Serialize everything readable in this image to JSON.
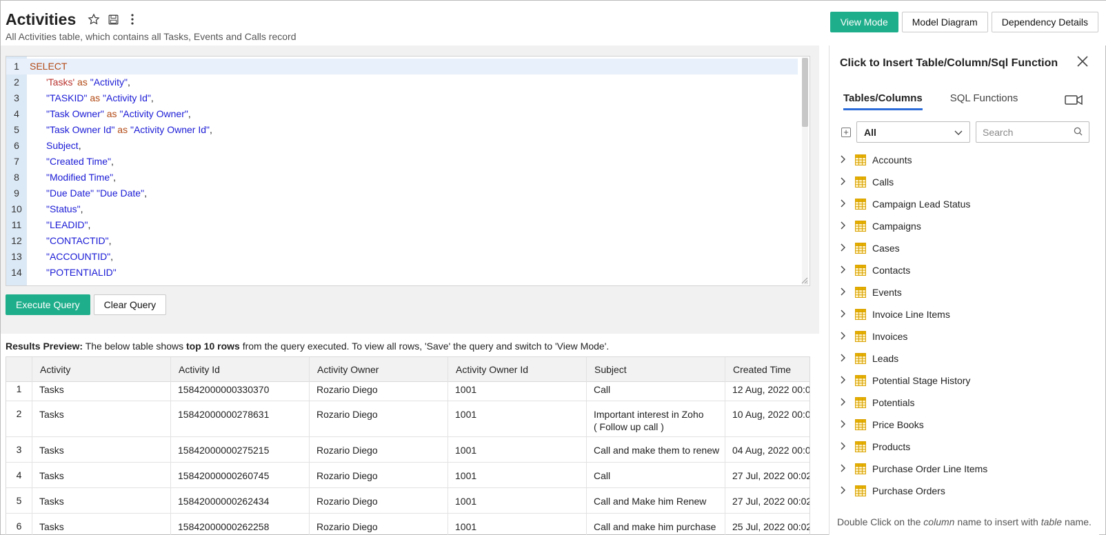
{
  "header": {
    "title": "Activities",
    "subtitle": "All Activities table, which contains all Tasks, Events and Calls record",
    "view_mode_label": "View Mode",
    "model_diagram_label": "Model Diagram",
    "dependency_details_label": "Dependency Details"
  },
  "editor": {
    "lines": [
      {
        "n": "1"
      },
      {
        "n": "2"
      },
      {
        "n": "3"
      },
      {
        "n": "4"
      },
      {
        "n": "5"
      },
      {
        "n": "6"
      },
      {
        "n": "7"
      },
      {
        "n": "8"
      },
      {
        "n": "9"
      },
      {
        "n": "10"
      },
      {
        "n": "11"
      },
      {
        "n": "12"
      },
      {
        "n": "13"
      },
      {
        "n": "14"
      }
    ],
    "tokens": {
      "l1": "SELECT",
      "l2a": "'Tasks'",
      "l2b": " as ",
      "l2c": "\"Activity\"",
      "l2d": ",",
      "l3a": "\"TASKID\"",
      "l3b": " as ",
      "l3c": "\"Activity Id\"",
      "l3d": ",",
      "l4a": "\"Task Owner\"",
      "l4b": " as ",
      "l4c": "\"Activity Owner\"",
      "l4d": ",",
      "l5a": "\"Task Owner Id\"",
      "l5b": " as ",
      "l5c": "\"Activity Owner Id\"",
      "l5d": ",",
      "l6a": "Subject",
      "l6b": ",",
      "l7a": "\"Created Time\"",
      "l7b": ",",
      "l8a": "\"Modified Time\"",
      "l8b": ",",
      "l9a": "\"Due Date\" \"Due Date\"",
      "l9b": ",",
      "l10a": "\"Status\"",
      "l10b": ",",
      "l11a": "\"LEADID\"",
      "l11b": ",",
      "l12a": "\"CONTACTID\"",
      "l12b": ",",
      "l13a": "\"ACCOUNTID\"",
      "l13b": ",",
      "l14a": "\"POTENTIALID\""
    },
    "execute_label": "Execute Query",
    "clear_label": "Clear Query"
  },
  "results": {
    "label_bold": "Results Preview:",
    "label_text1": " The below table shows ",
    "label_bold2": "top 10 rows",
    "label_text2": " from the query executed. To view all rows, 'Save' the query and switch to 'View Mode'.",
    "columns": [
      "Activity",
      "Activity Id",
      "Activity Owner",
      "Activity Owner Id",
      "Subject",
      "Created Time"
    ],
    "rows": [
      {
        "num": "1",
        "activity": "Tasks",
        "id": "15842000000330370",
        "owner": "Rozario Diego",
        "owner_id": "1001",
        "subject": "Call",
        "created": "12 Aug, 2022 00:0"
      },
      {
        "num": "2",
        "activity": "Tasks",
        "id": "15842000000278631",
        "owner": "Rozario Diego",
        "owner_id": "1001",
        "subject": "Important interest in Zoho ( Follow up call  )",
        "created": "10 Aug, 2022 00:0"
      },
      {
        "num": "3",
        "activity": "Tasks",
        "id": "15842000000275215",
        "owner": "Rozario Diego",
        "owner_id": "1001",
        "subject": "Call and make them to renew",
        "created": "04 Aug, 2022 00:0"
      },
      {
        "num": "4",
        "activity": "Tasks",
        "id": "15842000000260745",
        "owner": "Rozario Diego",
        "owner_id": "1001",
        "subject": "Call",
        "created": "27 Jul, 2022 00:02"
      },
      {
        "num": "5",
        "activity": "Tasks",
        "id": "15842000000262434",
        "owner": "Rozario Diego",
        "owner_id": "1001",
        "subject": "Call and Make him Renew",
        "created": "27 Jul, 2022 00:02"
      },
      {
        "num": "6",
        "activity": "Tasks",
        "id": "15842000000262258",
        "owner": "Rozario Diego",
        "owner_id": "1001",
        "subject": "Call and make him purchase",
        "created": "25 Jul, 2022 00:02"
      }
    ]
  },
  "panel": {
    "title": "Click to Insert Table/Column/Sql Function",
    "tab_tables": "Tables/Columns",
    "tab_functions": "SQL Functions",
    "filter_value": "All",
    "search_placeholder": "Search",
    "tables": [
      "Accounts",
      "Calls",
      "Campaign Lead Status",
      "Campaigns",
      "Cases",
      "Contacts",
      "Events",
      "Invoice Line Items",
      "Invoices",
      "Leads",
      "Potential Stage History",
      "Potentials",
      "Price Books",
      "Products",
      "Purchase Order Line Items",
      "Purchase Orders"
    ],
    "footer_a": "Double Click on the ",
    "footer_b": "column",
    "footer_c": " name to insert with ",
    "footer_d": "table",
    "footer_e": " name."
  },
  "colors": {
    "accent": "#1fae8b",
    "tab_underline": "#2a6bd8",
    "keyword": "#b24a15",
    "string_blue": "#1a1ad6",
    "string_red": "#b8322e",
    "gutter": "#dbe8f5",
    "table_icon": "#e0a800"
  }
}
